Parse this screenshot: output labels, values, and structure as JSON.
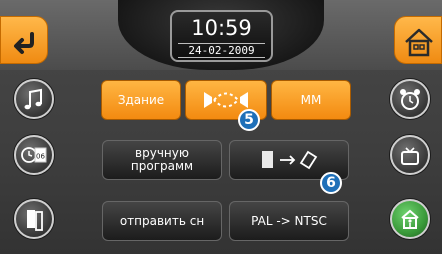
{
  "header": {
    "time": "10:59",
    "date": "24-02-2009"
  },
  "nav": {
    "back_icon": "back-arrow-icon",
    "home_icon": "home-icon"
  },
  "left_column": [
    {
      "icon": "music-note-icon"
    },
    {
      "icon": "clock-calendar-icon"
    },
    {
      "icon": "door-icon"
    }
  ],
  "right_column": [
    {
      "icon": "alarm-clock-icon"
    },
    {
      "icon": "tv-icon"
    },
    {
      "icon": "exit-icon"
    }
  ],
  "row1": {
    "building": "Здание",
    "link_icon": "dashed-link-icon",
    "mm": "MM"
  },
  "row2": {
    "manual": "вручную программ",
    "transfer_icon": "device-transfer-icon"
  },
  "row3": {
    "send": "отправить сн",
    "standard": "PAL -> NTSC"
  },
  "callouts": [
    "5",
    "6"
  ],
  "colors": {
    "accent": "#f39214",
    "callout": "#1e6fb8",
    "exit_green": "#3a9a3a"
  }
}
